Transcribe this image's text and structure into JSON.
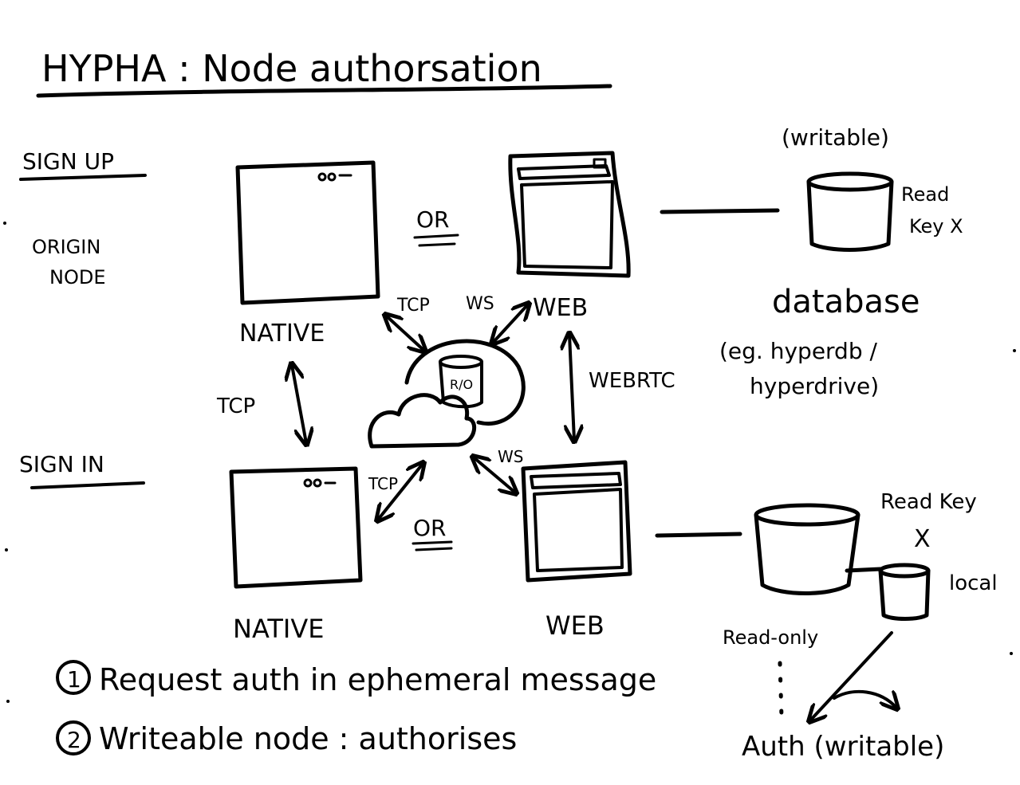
{
  "title": "HYPHA : Node authorsation",
  "sections": {
    "sign_up": "SIGN UP",
    "origin_node": [
      "ORIGIN",
      "NODE"
    ],
    "sign_in": "SIGN IN"
  },
  "labels": {
    "or_top": "OR",
    "or_bottom": "OR",
    "native_top": "NATIVE",
    "web_top": "WEB",
    "native_bottom": "NATIVE",
    "web_bottom": "WEB",
    "writable_top": "(writable)",
    "read_key_x_top": [
      "Read",
      "Key X"
    ],
    "database": "database",
    "database_examples": [
      "(eg. hyperdb /",
      "hyperdrive)"
    ],
    "read_key_bottom": "Read Key",
    "x_bottom": "X",
    "local": "local",
    "read_only": "Read-only",
    "auth_writable": "Auth (writable)",
    "ro_badge": "R/O"
  },
  "connections": {
    "tcp_top": "TCP",
    "ws_top": "WS",
    "webrtc": "WEBRTC",
    "tcp_left": "TCP",
    "tcp_bottom": "TCP",
    "ws_bottom": "WS"
  },
  "steps": [
    "1 Request auth in ephemeral message",
    "2 Writeable node : authorises"
  ],
  "steps_numbers": [
    "1",
    "2"
  ],
  "steps_text": [
    "Request auth in ephemeral message",
    "Writeable node : authorises"
  ]
}
